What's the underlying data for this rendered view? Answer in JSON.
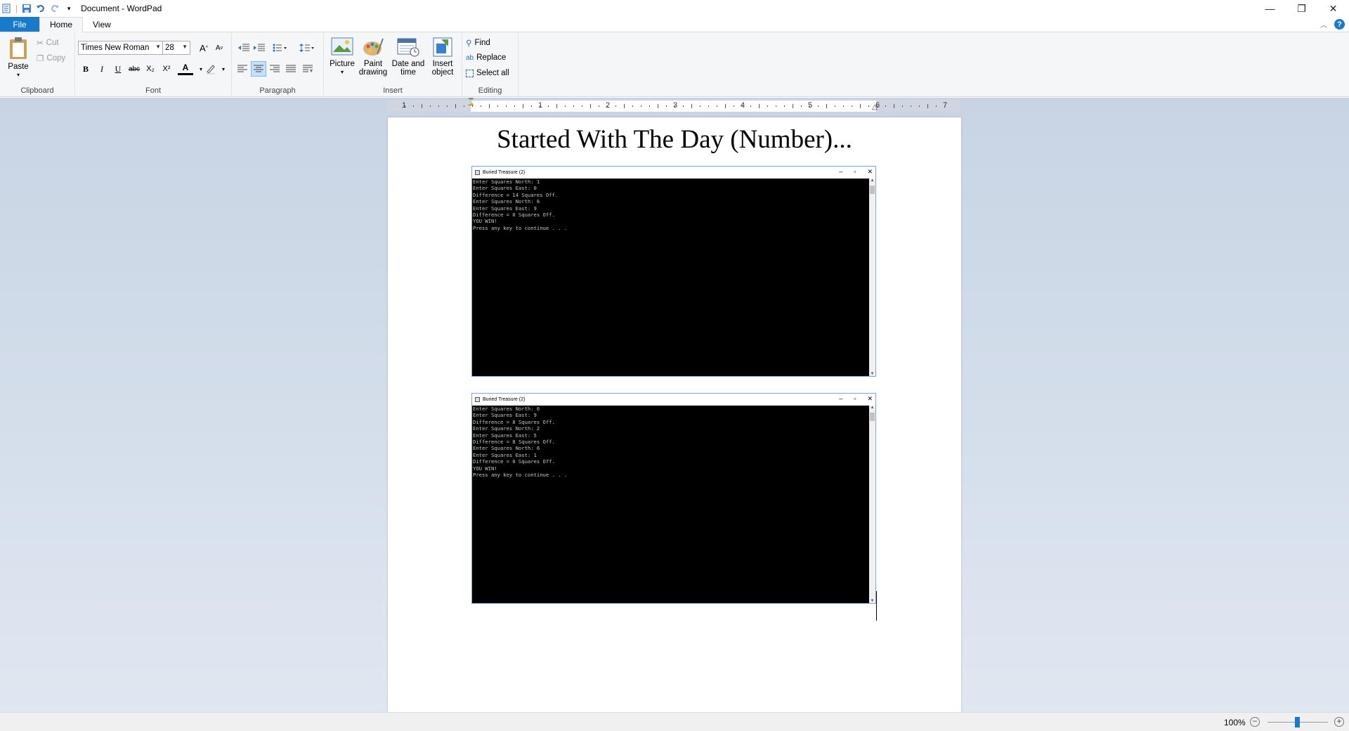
{
  "window": {
    "title": "Document - WordPad",
    "controls": {
      "minimize": "—",
      "restore": "❐",
      "close": "✕"
    }
  },
  "tabs": {
    "file": "File",
    "home": "Home",
    "view": "View"
  },
  "ribbon": {
    "clipboard": {
      "label": "Clipboard",
      "paste": "Paste",
      "cut": "Cut",
      "copy": "Copy"
    },
    "font": {
      "label": "Font",
      "family": "Times New Roman",
      "size": "28",
      "bold": "B",
      "italic": "I",
      "underline": "U",
      "strike": "abc",
      "subscript": "X₂",
      "superscript": "X²",
      "color_letter": "A",
      "grow": "A",
      "shrink": "A"
    },
    "paragraph": {
      "label": "Paragraph"
    },
    "insert": {
      "label": "Insert",
      "picture": "Picture",
      "paint": [
        "Paint",
        "drawing"
      ],
      "datetime": [
        "Date and",
        "time"
      ],
      "object": [
        "Insert",
        "object"
      ]
    },
    "editing": {
      "label": "Editing",
      "find": "Find",
      "replace": "Replace",
      "select_all": "Select all"
    }
  },
  "ruler": {
    "numbers": [
      "1",
      "1",
      "2",
      "3",
      "4",
      "5",
      "6",
      "7"
    ]
  },
  "document": {
    "heading": "Started With The Day (Number)...",
    "consoles": [
      {
        "title": "Buried Treasure (2)",
        "lines": [
          "Enter Squares North: 1",
          "Enter Squares East: 0",
          "Difference = 14 Squares Off.",
          "Enter Squares North: 6",
          "Enter Squares East: 9",
          "Difference = 0 Squares Off.",
          "YOU WIN!",
          "Press any key to continue . . ."
        ]
      },
      {
        "title": "Buried Treasure (2)",
        "lines": [
          "Enter Squares North: 6",
          "Enter Squares East: 9",
          "Difference = 8 Squares Off.",
          "Enter Squares North: 2",
          "Enter Squares East: 5",
          "Difference = 8 Squares Off.",
          "Enter Squares North: 6",
          "Enter Squares East: 1",
          "Difference = 0 Squares Off.",
          "YOU WIN!",
          "Press any key to continue . . ."
        ]
      }
    ]
  },
  "status": {
    "zoom": "100%"
  },
  "colors": {
    "accent": "#1979ca",
    "ribbon_bg": "#f5f6f7",
    "workspace": "#d2dceb"
  }
}
